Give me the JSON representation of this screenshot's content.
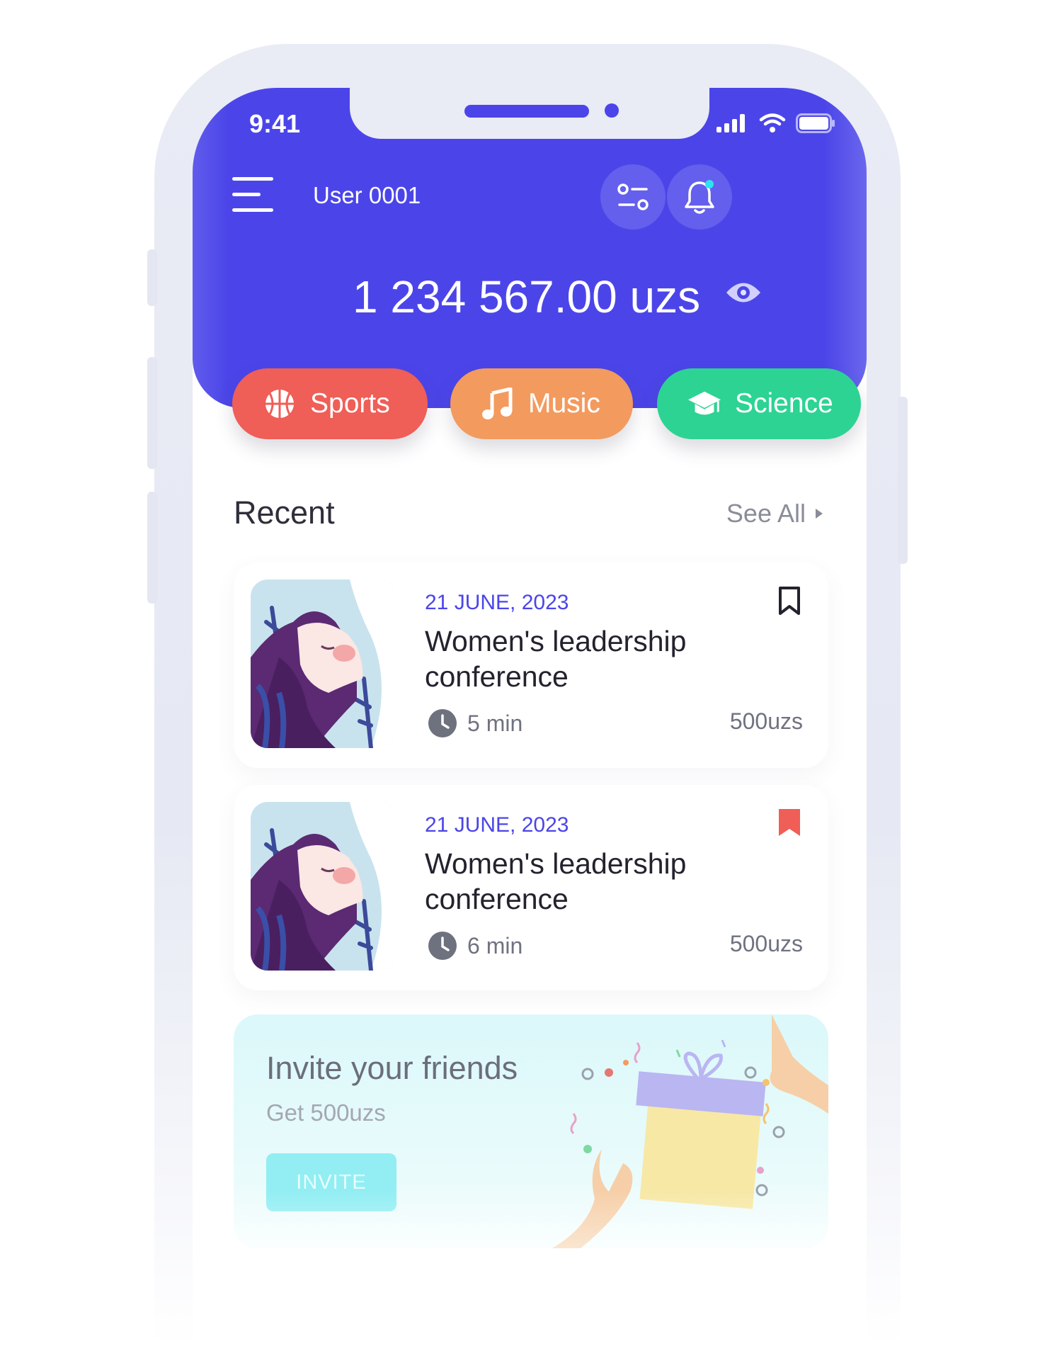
{
  "status_bar": {
    "time": "9:41"
  },
  "header": {
    "user_name": "User 0001",
    "balance": "1 234 567.00 uzs",
    "colors": {
      "background": "#4b45e9",
      "notification_dot": "#2ee3f0"
    }
  },
  "categories": [
    {
      "label": "Sports",
      "icon": "basketball-icon",
      "color": "#ef5e57"
    },
    {
      "label": "Music",
      "icon": "music-note-icon",
      "color": "#f39a5e"
    },
    {
      "label": "Science",
      "icon": "graduation-cap-icon",
      "color": "#2dd393"
    }
  ],
  "recent": {
    "title": "Recent",
    "see_all": "See All",
    "items": [
      {
        "date": "21 JUNE, 2023",
        "title": "Women's leadership conference",
        "duration": "5 min",
        "price": "500uzs",
        "bookmarked": false
      },
      {
        "date": "21 JUNE, 2023",
        "title": "Women's leadership conference",
        "duration": "6 min",
        "price": "500uzs",
        "bookmarked": true
      }
    ]
  },
  "invite": {
    "title": "Invite your friends",
    "subtitle": "Get 500uzs",
    "button": "INVITE"
  }
}
